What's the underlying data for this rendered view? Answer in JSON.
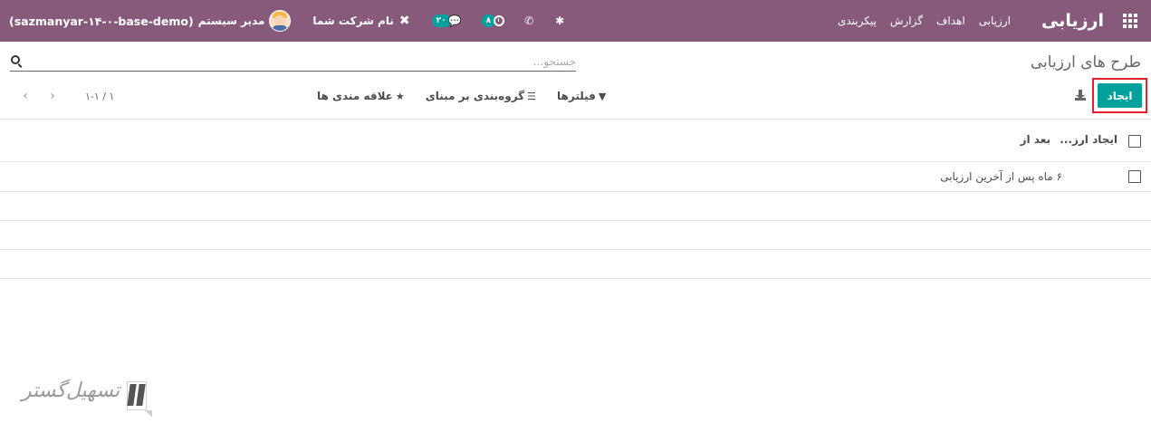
{
  "navbar": {
    "app_title": "ارزیابی",
    "menu": [
      {
        "label": "ارزیابی"
      },
      {
        "label": "اهداف"
      },
      {
        "label": "گزارش"
      },
      {
        "label": "پیکربندی"
      }
    ],
    "systray": {
      "database": "(sazmanyar-۱۴-۰-base-demo)",
      "user": "مدیر سیستم",
      "company": "نام شرکت شما",
      "messages_badge": "۲۰",
      "activities_badge": "۸"
    }
  },
  "control_panel": {
    "breadcrumb": "طرح های ارزیابی",
    "search_placeholder": "جستجو...",
    "create_label": "ایجاد",
    "filters_label": "فیلترها",
    "groupby_label": "گروه‌بندی بر مبنای",
    "favorites_label": "علاقه مندی ها",
    "pager_value": "۱-۱ / ۱"
  },
  "list": {
    "columns": [
      "ایجاد ارز...",
      "بعد از"
    ],
    "rows": [
      {
        "after": "۶ ماه پس از آخرین ارزیابی"
      }
    ]
  },
  "watermark": {
    "text": "تسهیل‌گستر"
  },
  "colors": {
    "navbar": "#875a7b",
    "primary": "#00a09d",
    "highlight": "#e0202a"
  }
}
